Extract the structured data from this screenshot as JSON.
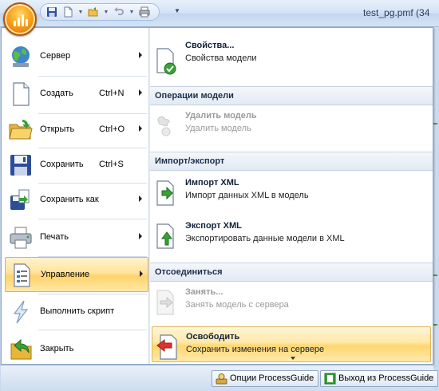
{
  "window": {
    "title": "test_pg.pmf (34"
  },
  "quick_access": {
    "items": [
      "save-icon",
      "new-icon",
      "open-icon",
      "undo-icon",
      "print-icon"
    ],
    "more_glyph": "▼"
  },
  "left_menu": {
    "items": [
      {
        "label": "Сервер",
        "shortcut": "",
        "has_submenu": true,
        "icon": "server-globe-icon"
      },
      {
        "label": "Создать",
        "shortcut": "Ctrl+N",
        "has_submenu": true,
        "icon": "new-document-icon"
      },
      {
        "label": "Открыть",
        "shortcut": "Ctrl+O",
        "has_submenu": true,
        "icon": "open-folder-icon"
      },
      {
        "label": "Сохранить",
        "shortcut": "Ctrl+S",
        "has_submenu": false,
        "icon": "save-disk-icon"
      },
      {
        "label": "Сохранить как",
        "shortcut": "",
        "has_submenu": true,
        "icon": "save-as-icon"
      },
      {
        "label": "Печать",
        "shortcut": "",
        "has_submenu": true,
        "icon": "printer-icon"
      },
      {
        "label": "Управление",
        "shortcut": "",
        "has_submenu": true,
        "icon": "manage-list-icon",
        "selected": true
      },
      {
        "label": "Выполнить скрипт",
        "shortcut": "",
        "has_submenu": false,
        "icon": "lightning-icon"
      },
      {
        "label": "Закрыть",
        "shortcut": "",
        "has_submenu": false,
        "icon": "close-back-arrow-icon"
      }
    ]
  },
  "right_panel": {
    "properties": {
      "title": "Свойства...",
      "desc": "Свойства модели"
    },
    "section_model_ops": "Операции модели",
    "delete_model": {
      "title": "Удалить модель",
      "desc": "Удалить модель",
      "disabled": true
    },
    "section_import_export": "Импорт/экспорт",
    "import_xml": {
      "title": "Импорт XML",
      "desc": "Импорт данных XML в модель"
    },
    "export_xml": {
      "title": "Экспорт XML",
      "desc": "Экспортировать данные модели в XML"
    },
    "section_disconnect": "Отсоединиться",
    "checkout": {
      "title": "Занять...",
      "desc": "Занять модель с сервера",
      "disabled": true
    },
    "release": {
      "title": "Освободить",
      "desc": "Сохранить изменения на сервере",
      "highlighted": true
    }
  },
  "bottom_bar": {
    "options_button": "Опции ProcessGuide",
    "exit_button": "Выход из ProcessGuide"
  },
  "colors": {
    "selection": "#ffd36b",
    "frame": "#8da7c8",
    "header_bg": "#e3eaf3"
  }
}
